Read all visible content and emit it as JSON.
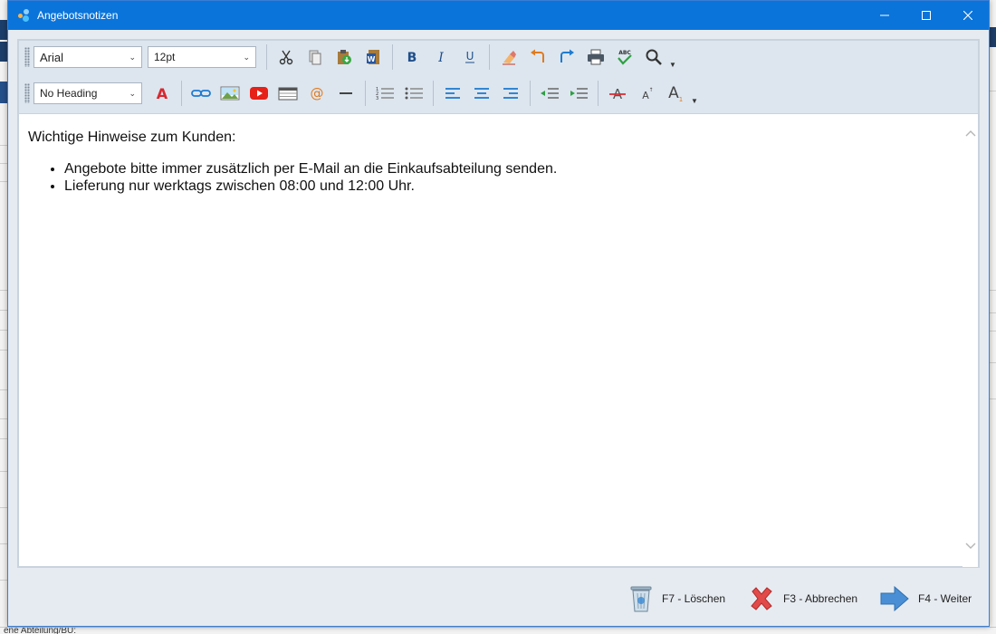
{
  "window": {
    "title": "Angebotsnotizen"
  },
  "toolbar": {
    "font_family": "Arial",
    "font_size": "12pt",
    "heading": "No Heading",
    "row1_icons": [
      "cut-icon",
      "copy-icon",
      "paste-icon",
      "paste-from-word-icon",
      "bold-icon",
      "italic-icon",
      "underline-icon",
      "clear-formatting-icon",
      "undo-icon",
      "redo-icon",
      "print-icon",
      "spellcheck-icon",
      "find-icon"
    ],
    "row2_icons": [
      "font-color-icon",
      "insert-link-icon",
      "insert-image-icon",
      "insert-video-icon",
      "insert-table-icon",
      "insert-email-icon",
      "horizontal-rule-icon",
      "ordered-list-icon",
      "unordered-list-icon",
      "align-left-icon",
      "align-center-icon",
      "align-right-icon",
      "outdent-icon",
      "indent-icon",
      "strikethrough-icon",
      "superscript-icon",
      "subscript-icon"
    ]
  },
  "document": {
    "heading": "Wichtige Hinweise zum Kunden:",
    "items": [
      "Angebote bitte immer zusätzlich per E-Mail an die Einkaufsabteilung senden.",
      "Lieferung nur werktags zwischen 08:00 und 12:00 Uhr."
    ]
  },
  "footer": {
    "delete_label": "F7 - Löschen",
    "cancel_label": "F3 - Abbrechen",
    "next_label": "F4 - Weiter"
  },
  "background": {
    "bottom_text": "ene Abteilung/BU:"
  },
  "colors": {
    "titlebar": "#0a74da",
    "accent_blue": "#1e7bd0",
    "red": "#d9282f"
  }
}
